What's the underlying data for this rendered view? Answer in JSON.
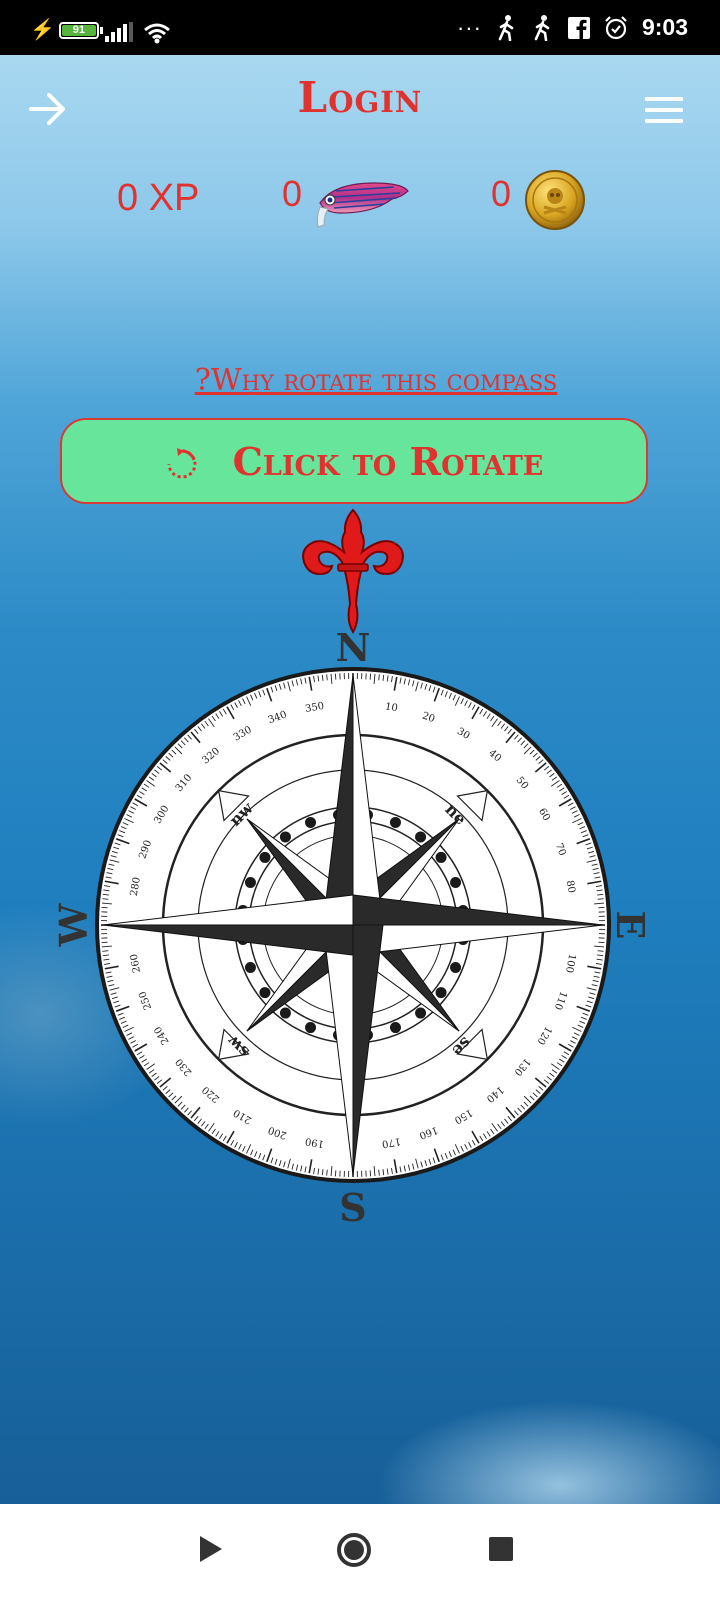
{
  "status_bar": {
    "battery_level": "91",
    "time": "9:03",
    "overflow_dots": "···",
    "icons": [
      "charging-icon",
      "battery-icon",
      "signal-icon",
      "wifi-icon",
      "walking-icon",
      "walking-icon",
      "facebook-icon",
      "alarm-icon"
    ]
  },
  "header": {
    "title": "Login",
    "back_icon": "arrow-right-icon",
    "menu_icon": "hamburger-menu-icon"
  },
  "stats": {
    "xp_text": "0 XP",
    "fish_count": "0",
    "coin_count": "0"
  },
  "compass_section": {
    "why_link": "?Why rotate this compass",
    "rotate_button_label": "Click  to Rotate",
    "rotate_icon": "rotate-icon",
    "cardinals": {
      "n": "N",
      "e": "E",
      "s": "S",
      "w": "W"
    },
    "intercardinals": {
      "ne": "ne",
      "nw": "nw",
      "se": "se",
      "sw": "sw"
    },
    "degree_labels": [
      "10",
      "20",
      "30",
      "40",
      "50",
      "60",
      "70",
      "80",
      "100",
      "110",
      "120",
      "130",
      "140",
      "150",
      "160",
      "170",
      "190",
      "200",
      "210",
      "220",
      "230",
      "240",
      "250",
      "260",
      "280",
      "290",
      "300",
      "310",
      "320",
      "330",
      "340",
      "350"
    ]
  },
  "colors": {
    "accent_red": "#e0332f",
    "button_green": "#66e59b",
    "sea_blue": "#1f7fbf"
  },
  "nav_bar": {
    "buttons": [
      "back-triangle-icon",
      "home-circle-icon",
      "recents-square-icon"
    ]
  }
}
